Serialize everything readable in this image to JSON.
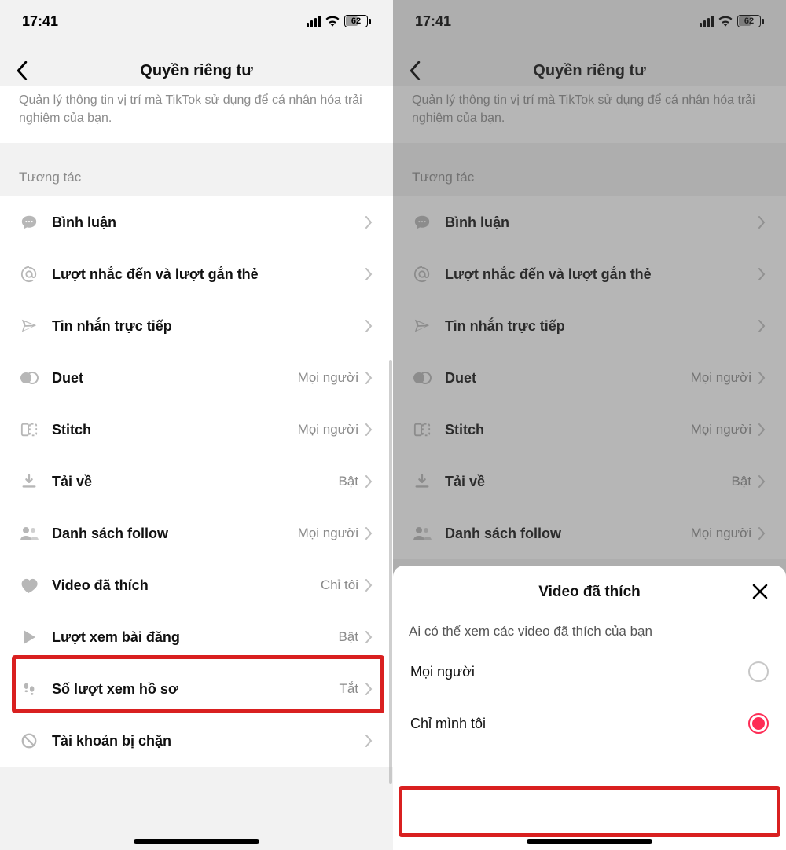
{
  "status": {
    "time": "17:41",
    "battery": "62"
  },
  "header": {
    "title": "Quyền riêng tư"
  },
  "descCard": "Quản lý thông tin vị trí mà TikTok sử dụng để cá nhân hóa trải nghiệm của bạn.",
  "sectionLabel": "Tương tác",
  "values": {
    "everyone": "Mọi người",
    "onlyMe": "Chỉ tôi",
    "on": "Bật",
    "off": "Tắt"
  },
  "rows": {
    "comments": {
      "label": "Bình luận"
    },
    "mentions": {
      "label": "Lượt nhắc đến và lượt gắn thẻ"
    },
    "dm": {
      "label": "Tin nhắn trực tiếp"
    },
    "duet": {
      "label": "Duet",
      "value": "Mọi người"
    },
    "stitch": {
      "label": "Stitch",
      "value": "Mọi người"
    },
    "download": {
      "label": "Tải về",
      "value": "Bật"
    },
    "following": {
      "label": "Danh sách follow",
      "value": "Mọi người"
    },
    "liked": {
      "label": "Video đã thích",
      "value": "Chỉ tôi"
    },
    "postviews": {
      "label": "Lượt xem bài đăng",
      "value": "Bật"
    },
    "profileviews": {
      "label": "Số lượt xem hồ sơ",
      "value": "Tắt"
    },
    "blocked": {
      "label": "Tài khoản bị chặn"
    }
  },
  "sheet": {
    "title": "Video đã thích",
    "subtitle": "Ai có thể xem các video đã thích của bạn",
    "optionEveryone": "Mọi người",
    "optionOnlyMe": "Chỉ mình tôi"
  }
}
